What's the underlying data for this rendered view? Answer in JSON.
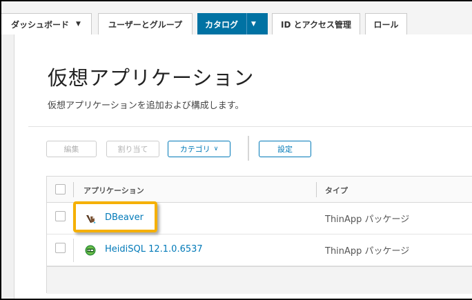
{
  "nav": {
    "tabs": [
      {
        "label": "ダッシュボード",
        "has_dropdown": true
      },
      {
        "label": "ユーザーとグループ",
        "has_dropdown": false
      },
      {
        "label": "カタログ",
        "has_dropdown": true,
        "active": true
      },
      {
        "label": "ID とアクセス管理",
        "has_dropdown": false
      },
      {
        "label": "ロール",
        "has_dropdown": false
      }
    ]
  },
  "page": {
    "title": "仮想アプリケーション",
    "subtitle": "仮想アプリケーションを追加および構成します。"
  },
  "toolbar": {
    "edit_label": "編集",
    "assign_label": "割り当て",
    "category_label": "カテゴリ",
    "settings_label": "設定"
  },
  "table": {
    "columns": [
      "アプリケーション",
      "タイプ"
    ],
    "rows": [
      {
        "name": "DBeaver",
        "type": "ThinApp パッケージ",
        "icon": "dbeaver-icon"
      },
      {
        "name": "HeidiSQL 12.1.0.6537",
        "type": "ThinApp パッケージ",
        "icon": "heidisql-icon"
      }
    ]
  },
  "colors": {
    "accent": "#0072a3",
    "link": "#0079b8",
    "highlight": "#f5b000"
  }
}
